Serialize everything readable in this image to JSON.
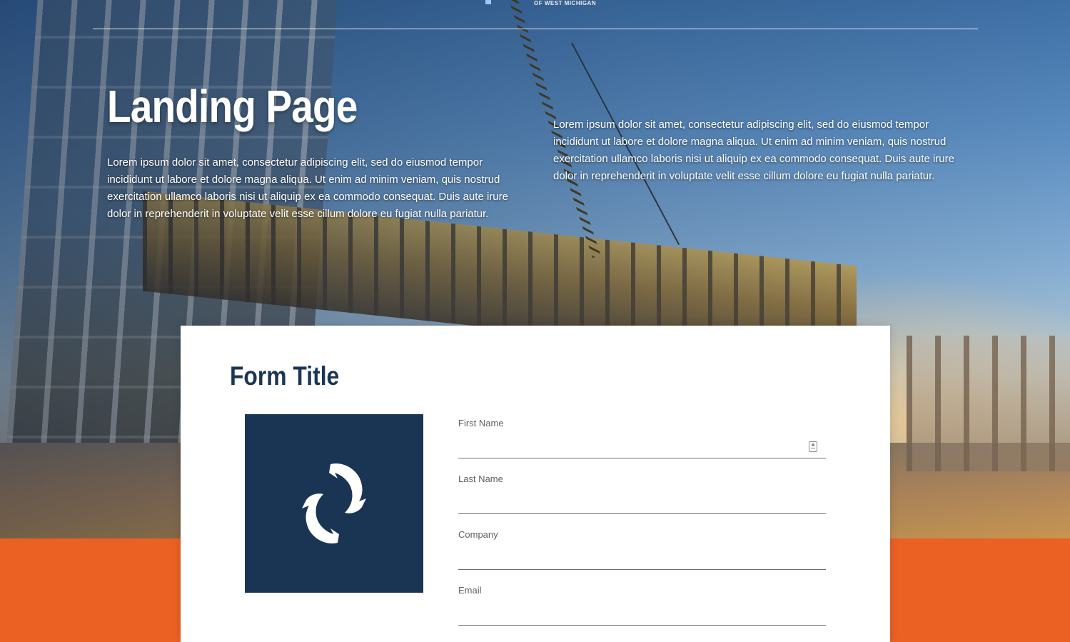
{
  "header": {
    "logo_subtitle": "OF WEST MICHIGAN"
  },
  "hero": {
    "title": "Landing Page",
    "paragraph_left": "Lorem ipsum dolor sit amet, consectetur adipiscing elit, sed do eiusmod tempor incididunt ut labore et dolore magna aliqua. Ut enim ad minim veniam, quis nostrud exercitation ullamco laboris nisi ut aliquip ex ea commodo consequat. Duis aute irure dolor in reprehenderit in voluptate velit esse cillum dolore eu fugiat nulla pariatur.",
    "paragraph_right": "Lorem ipsum dolor sit amet, consectetur adipiscing elit, sed do eiusmod tempor incididunt ut labore et dolore magna aliqua. Ut enim ad minim veniam, quis nostrud exercitation ullamco laboris nisi ut aliquip ex ea commodo consequat. Duis aute irure dolor in reprehenderit in voluptate velit esse cillum dolore eu fugiat nulla pariatur."
  },
  "form": {
    "title": "Form Title",
    "logo_icon": "sharks-circle-icon",
    "fields": [
      {
        "label": "First Name",
        "value": "",
        "icon": "contact-card-icon"
      },
      {
        "label": "Last Name",
        "value": ""
      },
      {
        "label": "Company",
        "value": ""
      },
      {
        "label": "Email",
        "value": ""
      }
    ]
  },
  "colors": {
    "accent_orange": "#eb6124",
    "navy": "#1b3654",
    "card_bg": "#ffffff"
  }
}
